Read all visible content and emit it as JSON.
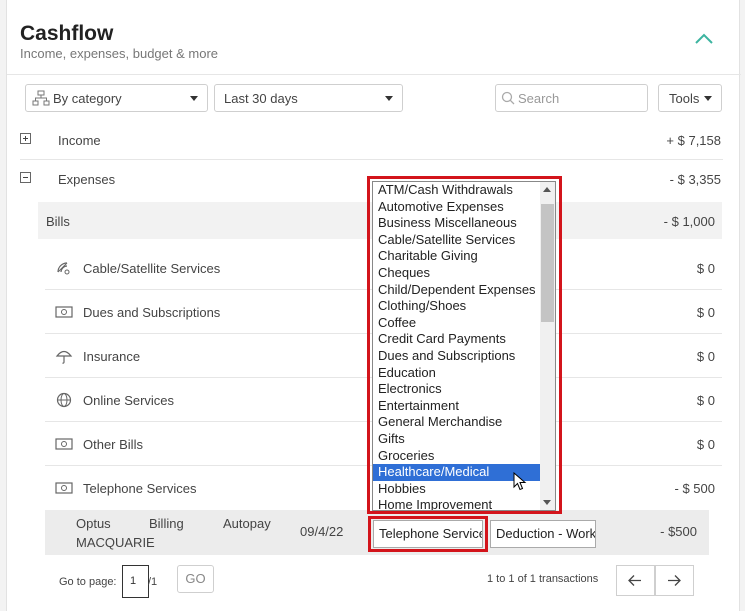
{
  "header": {
    "title": "Cashflow",
    "subtitle": "Income, expenses, budget & more"
  },
  "filters": {
    "category_view": "By category",
    "date_range": "Last 30 days",
    "search_placeholder": "Search",
    "tools_label": "Tools"
  },
  "summary": {
    "income": {
      "label": "Income",
      "amount": "+ $ 7,158"
    },
    "expenses": {
      "label": "Expenses",
      "amount": "- $ 3,355"
    },
    "bills": {
      "label": "Bills",
      "amount": "- $ 1,000"
    }
  },
  "categories": [
    {
      "label": "Cable/Satellite Services",
      "amount": "$ 0",
      "icon": "satellite-icon"
    },
    {
      "label": "Dues and Subscriptions",
      "amount": "$ 0",
      "icon": "money-icon"
    },
    {
      "label": "Insurance",
      "amount": "$ 0",
      "icon": "umbrella-icon"
    },
    {
      "label": "Online Services",
      "amount": "$ 0",
      "icon": "globe-icon"
    },
    {
      "label": "Other Bills",
      "amount": "$ 0",
      "icon": "money-icon"
    },
    {
      "label": "Telephone Services",
      "amount": "- $ 500",
      "icon": "money-icon"
    }
  ],
  "transaction": {
    "description_line1": "Optus",
    "description_line2": "MACQUARIE",
    "col2": "Billing",
    "col3": "Autopay",
    "date": "09/4/22",
    "category": "Telephone Service",
    "type": "Deduction - Work",
    "amount": "- $500"
  },
  "category_list": {
    "options": [
      "ATM/Cash Withdrawals",
      "Automotive Expenses",
      "Business Miscellaneous",
      "Cable/Satellite Services",
      "Charitable Giving",
      "Cheques",
      "Child/Dependent Expenses",
      "Clothing/Shoes",
      "Coffee",
      "Credit Card Payments",
      "Dues and Subscriptions",
      "Education",
      "Electronics",
      "Entertainment",
      "General Merchandise",
      "Gifts",
      "Groceries",
      "Healthcare/Medical",
      "Hobbies",
      "Home Improvement"
    ],
    "selected": "Healthcare/Medical"
  },
  "pagination": {
    "go_to_label": "Go to page:",
    "page": "1",
    "of_label": "/1",
    "go_label": "GO",
    "summary": "1 to 1 of 1 transactions"
  },
  "colors": {
    "accent_teal": "#3cb4a0",
    "highlight_red": "#d3141b",
    "selected_blue": "#2f6fd6"
  }
}
